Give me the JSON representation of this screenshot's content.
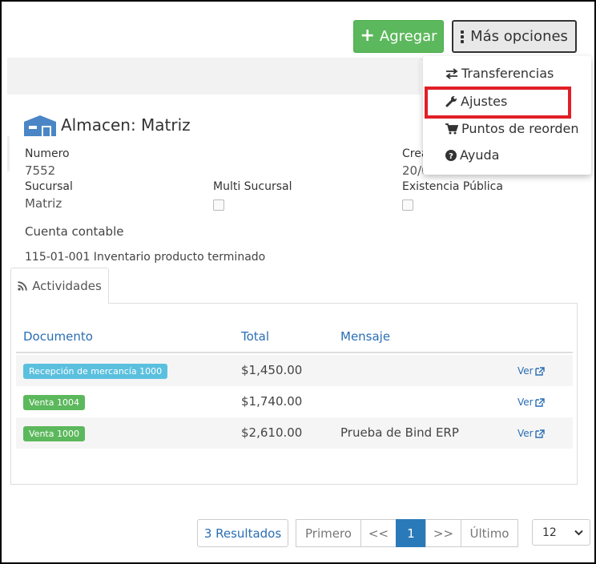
{
  "toolbar": {
    "add_label": "Agregar",
    "more_label": "Más opciones"
  },
  "dropdown": {
    "items": [
      {
        "label": "Transferencias",
        "icon": "transfer-icon"
      },
      {
        "label": "Ajustes",
        "icon": "wrench-icon"
      },
      {
        "label": "Puntos de reorden",
        "icon": "cart-icon"
      },
      {
        "label": "Ayuda",
        "icon": "question-circle-icon"
      }
    ],
    "highlighted_item": "Ajustes",
    "highlight_color": "#e01e26"
  },
  "warehouse": {
    "title": "Almacen: Matriz",
    "fields": {
      "numero_label": "Numero",
      "numero_value": "7552",
      "creado_label": "Crea",
      "creado_value": "20/0",
      "sucursal_label": "Sucursal",
      "sucursal_value": "Matriz",
      "multi_sucursal_label": "Multi Sucursal",
      "existencia_label": "Existencia Pública",
      "cuenta_label": "Cuenta contable",
      "cuenta_value": "115-01-001 Inventario producto terminado"
    }
  },
  "activities": {
    "tab_label": "Actividades",
    "columns": [
      "Documento",
      "Total",
      "Mensaje"
    ],
    "rows": [
      {
        "documento": "Recepción de mercancía 1000",
        "badge_color": "#5bc0de",
        "total": "$1,450.00",
        "mensaje": "",
        "link": "Ver"
      },
      {
        "documento": "Venta 1004",
        "badge_color": "#5cb85c",
        "total": "$1,740.00",
        "mensaje": "",
        "link": "Ver"
      },
      {
        "documento": "Venta 1000",
        "badge_color": "#5cb85c",
        "total": "$2,610.00",
        "mensaje": "Prueba de Bind ERP",
        "link": "Ver"
      }
    ]
  },
  "pagination": {
    "results": "3 Resultados",
    "first": "Primero",
    "prev": "<<",
    "current": "1",
    "next": ">>",
    "last": "Último",
    "page_size": "12"
  },
  "colors": {
    "primary_link": "#2a6eb3",
    "success": "#5cb85c",
    "info": "#5bc0de",
    "active_page": "#2a7ab9"
  }
}
